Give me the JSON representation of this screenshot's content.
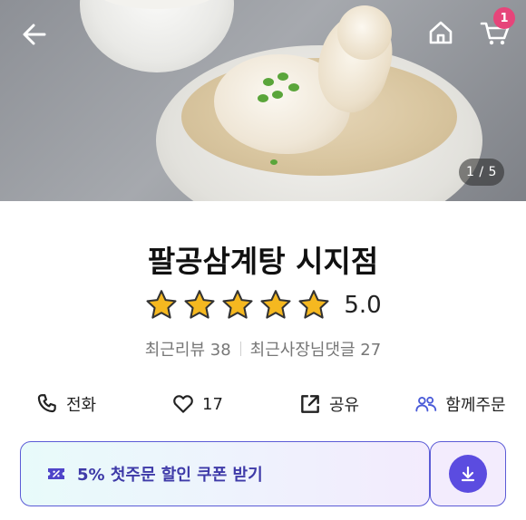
{
  "header": {
    "back_icon": "arrow-left-icon",
    "home_icon": "home-icon",
    "cart_icon": "cart-icon",
    "cart_badge": "1"
  },
  "gallery": {
    "counter": "1 / 5"
  },
  "store": {
    "name": "팔공삼계탕 시지점",
    "rating": "5.0",
    "stars_filled": 5,
    "stars_total": 5,
    "recent_reviews": "최근리뷰 38",
    "owner_replies": "최근사장님댓글 27"
  },
  "actions": {
    "call_label": "전화",
    "call_icon": "phone-icon",
    "like_count": "17",
    "like_icon": "heart-icon",
    "share_label": "공유",
    "share_icon": "share-icon",
    "group_label": "함께주문",
    "group_icon": "group-icon"
  },
  "coupon": {
    "label": "5% 첫주문 할인 쿠폰 받기",
    "coupon_icon": "coupon-icon",
    "download_icon": "download-icon"
  },
  "colors": {
    "accent": "#5b4ce0",
    "badge": "#e6457a",
    "star": "#f5b820"
  }
}
